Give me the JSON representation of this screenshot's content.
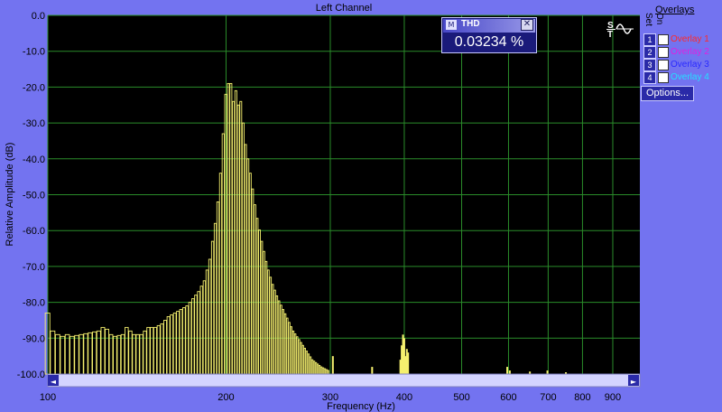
{
  "chart_data": {
    "type": "bar",
    "title": "Left Channel",
    "xlabel": "Frequency (Hz)",
    "ylabel": "Relative Amplitude (dB)",
    "xscale": "log",
    "xlim": [
      100,
      1000
    ],
    "ylim": [
      -100,
      0
    ],
    "x_ticks": [
      {
        "value": 100,
        "label": "100"
      },
      {
        "value": 200,
        "label": "200"
      },
      {
        "value": 300,
        "label": "300"
      },
      {
        "value": 400,
        "label": "400"
      },
      {
        "value": 500,
        "label": "500"
      },
      {
        "value": 600,
        "label": "600"
      },
      {
        "value": 700,
        "label": "700"
      },
      {
        "value": 800,
        "label": "800"
      },
      {
        "value": 900,
        "label": "900"
      }
    ],
    "y_ticks": [
      {
        "value": 0,
        "label": "0.0"
      },
      {
        "value": -10,
        "label": "-10.0"
      },
      {
        "value": -20,
        "label": "-20.0"
      },
      {
        "value": -30,
        "label": "-30.0"
      },
      {
        "value": -40,
        "label": "-40.0"
      },
      {
        "value": -50,
        "label": "-50.0"
      },
      {
        "value": -60,
        "label": "-60.0"
      },
      {
        "value": -70,
        "label": "-70.0"
      },
      {
        "value": -80,
        "label": "-80.0"
      },
      {
        "value": -90,
        "label": "-90.0"
      },
      {
        "value": -100,
        "label": "-100.0"
      }
    ],
    "grid": true,
    "colors": {
      "background": "#000000",
      "grid": "#2a8c2a",
      "bars": "#f5f06e"
    },
    "spectrum": {
      "bin_hz": 2.0,
      "noise_floor_db": -100,
      "points": [
        [
          100,
          -83
        ],
        [
          101,
          -84
        ],
        [
          102,
          -88
        ],
        [
          104,
          -89
        ],
        [
          106,
          -89.5
        ],
        [
          108,
          -89
        ],
        [
          110,
          -89.5
        ],
        [
          114,
          -89
        ],
        [
          118,
          -88.5
        ],
        [
          122,
          -88
        ],
        [
          124,
          -87
        ],
        [
          126,
          -87.5
        ],
        [
          128,
          -89
        ],
        [
          130,
          -89.5
        ],
        [
          134,
          -89
        ],
        [
          136,
          -87
        ],
        [
          140,
          -89
        ],
        [
          144,
          -89
        ],
        [
          148,
          -87
        ],
        [
          152,
          -87
        ],
        [
          156,
          -86
        ],
        [
          158,
          -85
        ],
        [
          160,
          -84
        ],
        [
          164,
          -83
        ],
        [
          168,
          -82
        ],
        [
          172,
          -81
        ],
        [
          176,
          -79
        ],
        [
          180,
          -77
        ],
        [
          184,
          -74
        ],
        [
          188,
          -68
        ],
        [
          190,
          -63
        ],
        [
          192,
          -58
        ],
        [
          194,
          -52
        ],
        [
          196,
          -44
        ],
        [
          198,
          -33
        ],
        [
          199,
          -27
        ],
        [
          200,
          -22
        ],
        [
          201,
          -20
        ],
        [
          202,
          -19
        ],
        [
          203,
          -17
        ],
        [
          204,
          -19
        ],
        [
          206,
          -24
        ],
        [
          208,
          -21
        ],
        [
          210,
          -25
        ],
        [
          211,
          -22
        ],
        [
          212,
          -24
        ],
        [
          214,
          -30
        ],
        [
          216,
          -36
        ],
        [
          220,
          -44
        ],
        [
          225,
          -55
        ],
        [
          230,
          -63
        ],
        [
          235,
          -70
        ],
        [
          240,
          -75
        ],
        [
          245,
          -79
        ],
        [
          250,
          -82
        ],
        [
          255,
          -85
        ],
        [
          260,
          -88
        ],
        [
          265,
          -90
        ],
        [
          270,
          -92
        ],
        [
          275,
          -94
        ],
        [
          280,
          -96
        ],
        [
          285,
          -97
        ],
        [
          290,
          -98
        ],
        [
          298,
          -99
        ],
        [
          300,
          -100
        ]
      ],
      "peaks": [
        {
          "f": 303,
          "db": -95,
          "width_hz": 2
        },
        {
          "f": 353,
          "db": -98,
          "width_hz": 2
        },
        {
          "f": 394,
          "db": -96,
          "width_hz": 2
        },
        {
          "f": 396,
          "db": -92,
          "width_hz": 2
        },
        {
          "f": 398,
          "db": -89,
          "width_hz": 2
        },
        {
          "f": 400,
          "db": -90,
          "width_hz": 2
        },
        {
          "f": 402,
          "db": -95,
          "width_hz": 2
        },
        {
          "f": 404,
          "db": -93,
          "width_hz": 2
        },
        {
          "f": 406,
          "db": -94,
          "width_hz": 2
        },
        {
          "f": 597,
          "db": -98,
          "width_hz": 3
        },
        {
          "f": 603,
          "db": -99,
          "width_hz": 3
        },
        {
          "f": 652,
          "db": -99.3,
          "width_hz": 2
        },
        {
          "f": 698,
          "db": -99,
          "width_hz": 3
        },
        {
          "f": 750,
          "db": -99.5,
          "width_hz": 2
        }
      ]
    }
  },
  "thd_meter": {
    "title": "THD",
    "value": "0.03234 %",
    "close_glyph": "✕",
    "icon": "meter-window-icon"
  },
  "overlays": {
    "title": "Overlays",
    "set_label": "Set",
    "on_label": "On",
    "items": [
      {
        "number": "1",
        "label": "Overlay 1",
        "color": "#ff2a2a",
        "checked": false
      },
      {
        "number": "2",
        "label": "Overlay 2",
        "color": "#e020e0",
        "checked": false
      },
      {
        "number": "3",
        "label": "Overlay 3",
        "color": "#2a2aff",
        "checked": false
      },
      {
        "number": "4",
        "label": "Overlay 4",
        "color": "#22e0ff",
        "checked": false
      }
    ],
    "options_label": "Options..."
  },
  "st_icon": {
    "label_s": "S",
    "label_t": "T",
    "icon": "sine-wave-icon"
  },
  "scrollbar": {
    "left_arrow": "◄",
    "right_arrow": "►"
  }
}
